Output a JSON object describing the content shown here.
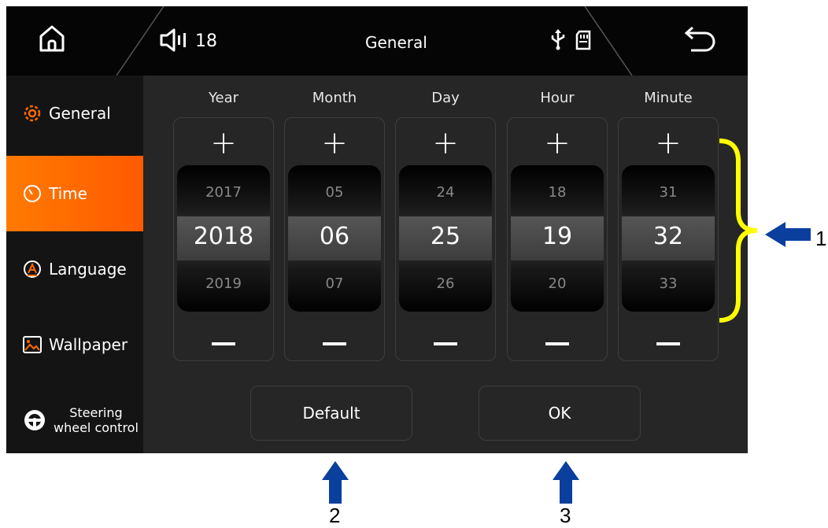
{
  "topbar": {
    "title": "General",
    "volume_value": "18",
    "icons": [
      "home-icon",
      "speaker-icon",
      "usb-icon",
      "sd-card-icon",
      "back-icon"
    ]
  },
  "sidebar": {
    "items": [
      {
        "label": "General",
        "icon": "gear-icon",
        "active": false
      },
      {
        "label": "Time",
        "icon": "clock-icon",
        "active": true
      },
      {
        "label": "Language",
        "icon": "language-icon",
        "active": false
      },
      {
        "label": "Wallpaper",
        "icon": "wallpaper-icon",
        "active": false
      },
      {
        "label_line1": "Steering",
        "label_line2": "wheel control",
        "icon": "steering-wheel-icon",
        "active": false
      }
    ]
  },
  "pickers": [
    {
      "label": "Year",
      "prev": "2017",
      "value": "2018",
      "next": "2019"
    },
    {
      "label": "Month",
      "prev": "05",
      "value": "06",
      "next": "07"
    },
    {
      "label": "Day",
      "prev": "24",
      "value": "25",
      "next": "26"
    },
    {
      "label": "Hour",
      "prev": "18",
      "value": "19",
      "next": "20"
    },
    {
      "label": "Minute",
      "prev": "31",
      "value": "32",
      "next": "33"
    }
  ],
  "buttons": {
    "default_label": "Default",
    "ok_label": "OK"
  },
  "annotations": {
    "one": "1",
    "two": "2",
    "three": "3"
  },
  "colors": {
    "accent": "#ff6a00",
    "annotation_bracket": "#ffff00",
    "annotation_arrow": "#0a3f9e"
  }
}
